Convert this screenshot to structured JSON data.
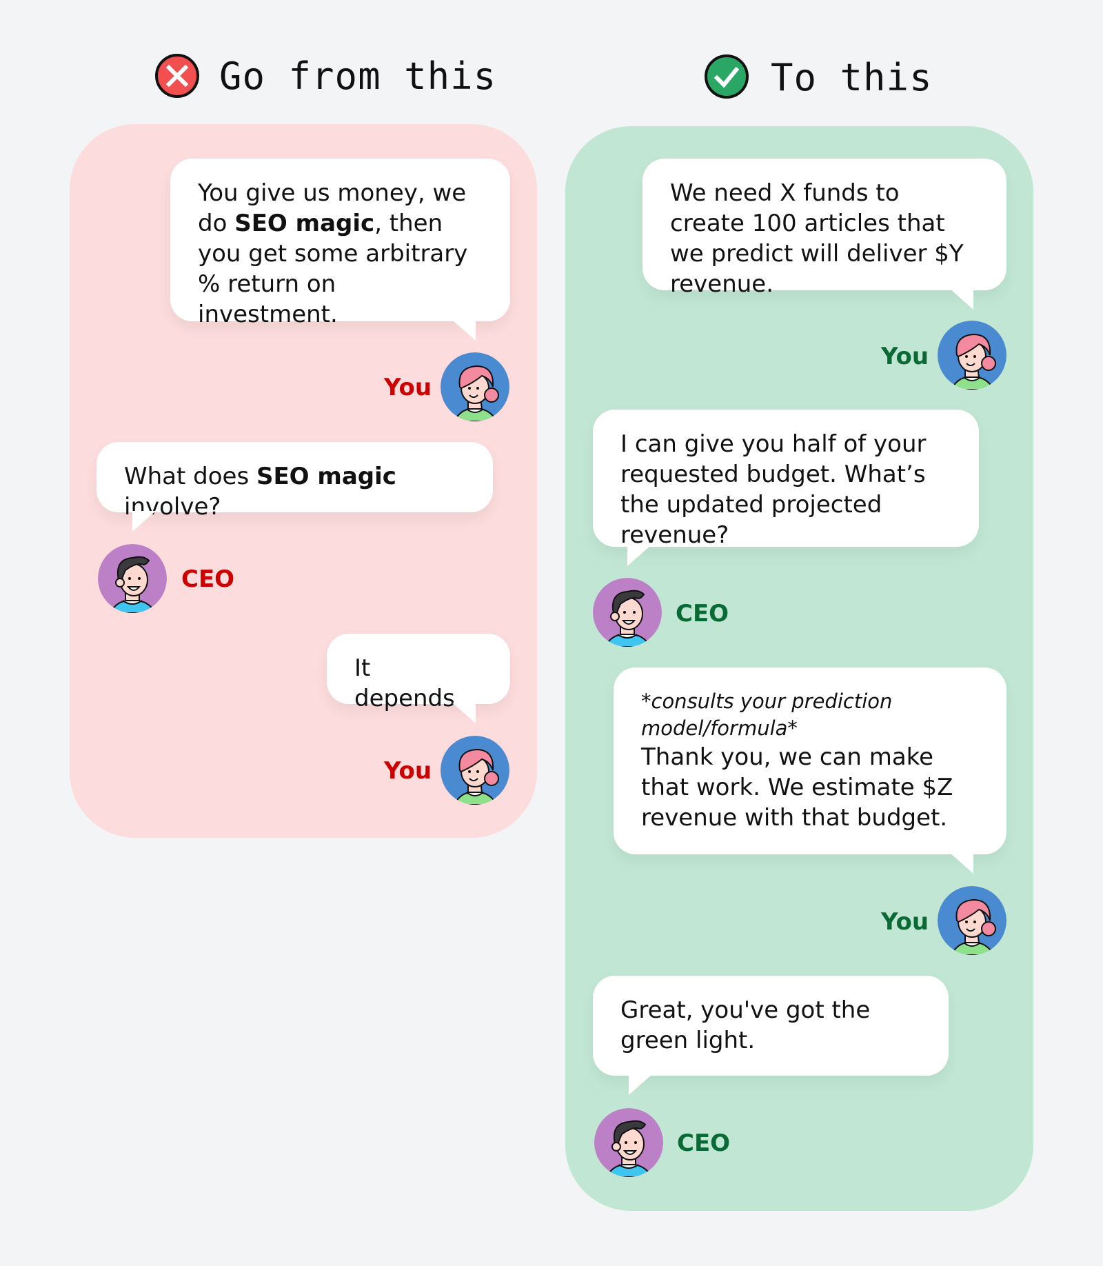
{
  "headers": {
    "left": {
      "label": "Go from this",
      "icon": "x-circle-icon",
      "icon_color": "#f25050"
    },
    "right": {
      "label": "To this",
      "icon": "check-circle-icon",
      "icon_color": "#2aa765"
    }
  },
  "colors": {
    "bad_panel": "#fcdcdd",
    "good_panel": "#c1e7d4",
    "bad_name": "#cc0000",
    "good_name": "#0a6a35",
    "background": "#f3f4f6"
  },
  "bad_conversation": [
    {
      "speaker": "You",
      "parts": [
        "You give us money, we do ",
        "SEO magic",
        ", then you get some arbitrary % return on investment."
      ]
    },
    {
      "speaker": "CEO",
      "parts": [
        "What does ",
        "SEO magic",
        " involve?"
      ]
    },
    {
      "speaker": "You",
      "text": "It depends."
    }
  ],
  "good_conversation": [
    {
      "speaker": "You",
      "text": "We need X funds to create 100 articles that we predict will deliver $Y revenue."
    },
    {
      "speaker": "CEO",
      "text": "I can give you half of your requested budget. What’s the updated projected revenue?"
    },
    {
      "speaker": "You",
      "aside": "*consults your prediction model/formula*",
      "text": "Thank you, we can make that work. We estimate $Z revenue with that budget."
    },
    {
      "speaker": "CEO",
      "text": "Great, you've got the green light."
    }
  ]
}
